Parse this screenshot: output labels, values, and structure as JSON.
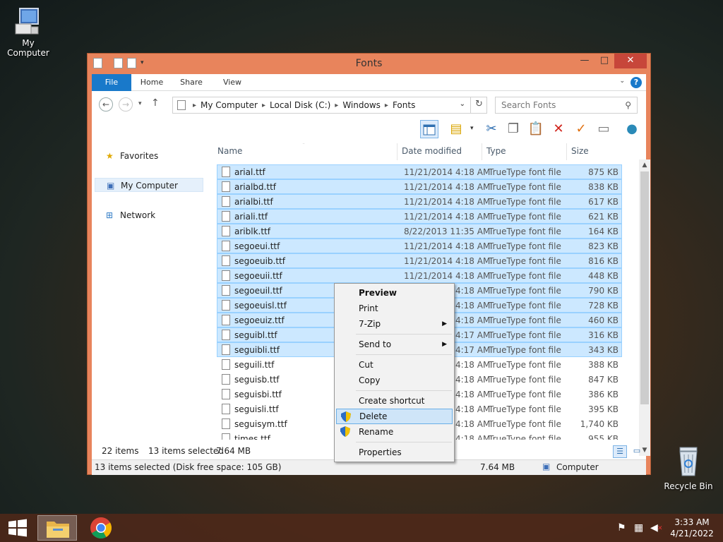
{
  "desktop": {
    "my_computer_label": "My Computer",
    "recycle_bin_label": "Recycle Bin"
  },
  "window": {
    "title": "Fonts",
    "minimize": "—",
    "maximize": "□",
    "close": "✕"
  },
  "ribbon": {
    "tabs": [
      "File",
      "Home",
      "Share",
      "View"
    ],
    "help": "?"
  },
  "address": {
    "segments": [
      "My Computer",
      "Local Disk (C:)",
      "Windows",
      "Fonts"
    ],
    "search_placeholder": "Search Fonts"
  },
  "nav_pane": {
    "favorites": "Favorites",
    "my_computer": "My Computer",
    "network": "Network"
  },
  "columns": {
    "name": "Name",
    "date": "Date modified",
    "type": "Type",
    "size": "Size"
  },
  "files": [
    {
      "name": "arial.ttf",
      "date": "11/21/2014 4:18 AM",
      "type": "TrueType font file",
      "size": "875 KB"
    },
    {
      "name": "arialbd.ttf",
      "date": "11/21/2014 4:18 AM",
      "type": "TrueType font file",
      "size": "838 KB"
    },
    {
      "name": "arialbi.ttf",
      "date": "11/21/2014 4:18 AM",
      "type": "TrueType font file",
      "size": "617 KB"
    },
    {
      "name": "ariali.ttf",
      "date": "11/21/2014 4:18 AM",
      "type": "TrueType font file",
      "size": "621 KB"
    },
    {
      "name": "ariblk.ttf",
      "date": "8/22/2013 11:35 AM",
      "type": "TrueType font file",
      "size": "164 KB"
    },
    {
      "name": "segoeui.ttf",
      "date": "11/21/2014 4:18 AM",
      "type": "TrueType font file",
      "size": "823 KB"
    },
    {
      "name": "segoeuib.ttf",
      "date": "11/21/2014 4:18 AM",
      "type": "TrueType font file",
      "size": "816 KB"
    },
    {
      "name": "segoeuii.ttf",
      "date": "11/21/2014 4:18 AM",
      "type": "TrueType font file",
      "size": "448 KB"
    },
    {
      "name": "segoeuil.ttf",
      "date": "11/21/2014 4:18 AM",
      "type": "TrueType font file",
      "size": "790 KB"
    },
    {
      "name": "segoeuisl.ttf",
      "date": "11/21/2014 4:18 AM",
      "type": "TrueType font file",
      "size": "728 KB"
    },
    {
      "name": "segoeuiz.ttf",
      "date": "11/21/2014 4:18 AM",
      "type": "TrueType font file",
      "size": "460 KB"
    },
    {
      "name": "seguibl.ttf",
      "date": "11/21/2014 4:17 AM",
      "type": "TrueType font file",
      "size": "316 KB"
    },
    {
      "name": "seguibli.ttf",
      "date": "11/21/2014 4:17 AM",
      "type": "TrueType font file",
      "size": "343 KB"
    },
    {
      "name": "seguili.ttf",
      "date": "11/21/2014 4:18 AM",
      "type": "TrueType font file",
      "size": "388 KB"
    },
    {
      "name": "seguisb.ttf",
      "date": "11/21/2014 4:18 AM",
      "type": "TrueType font file",
      "size": "847 KB"
    },
    {
      "name": "seguisbi.ttf",
      "date": "11/21/2014 4:18 AM",
      "type": "TrueType font file",
      "size": "386 KB"
    },
    {
      "name": "seguisli.ttf",
      "date": "11/21/2014 4:18 AM",
      "type": "TrueType font file",
      "size": "395 KB"
    },
    {
      "name": "seguisym.ttf",
      "date": "11/21/2014 4:18 AM",
      "type": "TrueType font file",
      "size": "1,740 KB"
    },
    {
      "name": "times.ttf",
      "date": "11/21/2014 4:18 AM",
      "type": "TrueType font file",
      "size": "955 KB"
    }
  ],
  "selected_count": 13,
  "status": {
    "items": "22 items",
    "selected": "13 items selected",
    "selected_size": "7.64 MB",
    "bottom_left": "13 items selected (Disk free space: 105 GB)",
    "bottom_size": "7.64 MB",
    "bottom_location": "Computer"
  },
  "context_menu": {
    "preview": "Preview",
    "print": "Print",
    "zip": "7-Zip",
    "send_to": "Send to",
    "cut": "Cut",
    "copy": "Copy",
    "create_shortcut": "Create shortcut",
    "delete": "Delete",
    "rename": "Rename",
    "properties": "Properties"
  },
  "taskbar": {
    "time": "3:33 AM",
    "date": "4/21/2022"
  },
  "colors": {
    "window_frame": "#e8845c",
    "accent": "#1979ca",
    "selection": "#cce8ff"
  }
}
